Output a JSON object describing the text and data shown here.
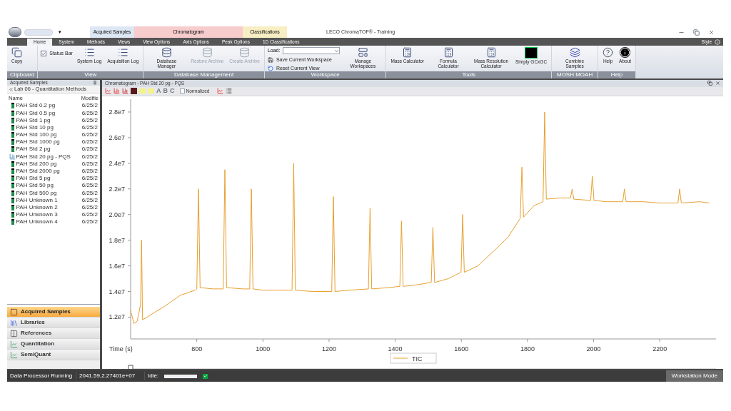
{
  "window": {
    "title": "LECO ChromaTOF® - Training",
    "quick_access_caret": "▾"
  },
  "context_groups": [
    {
      "label": "Acquired Samples",
      "color": "#dde7f4"
    },
    {
      "label": "Chromatogram",
      "color": "#f6cccc"
    },
    {
      "label": "Classifications",
      "color": "#f8eec4"
    }
  ],
  "tabs": [
    {
      "label": "Home",
      "selected": true
    },
    {
      "label": "System",
      "selected": false
    },
    {
      "label": "Methods",
      "selected": false
    },
    {
      "label": "Views",
      "selected": false
    },
    {
      "label": "View Options",
      "selected": false
    },
    {
      "label": "Axis Options",
      "selected": false
    },
    {
      "label": "Peak Options",
      "selected": false
    },
    {
      "label": "1D Classifications",
      "selected": false
    }
  ],
  "style_label": "Style",
  "ribbon": [
    {
      "label": "Clipboard",
      "items": [
        {
          "kind": "copy",
          "label": "Copy"
        }
      ]
    },
    {
      "label": "View",
      "items": [
        {
          "kind": "check",
          "label": "Status Bar",
          "checked": true
        },
        {
          "kind": "log",
          "label": "System Log"
        },
        {
          "kind": "log",
          "label": "Acquisition Log"
        }
      ]
    },
    {
      "label": "Database Management",
      "items": [
        {
          "kind": "database",
          "label": "Database Manager",
          "disabled": false
        },
        {
          "kind": "database",
          "label": "Restore Archive",
          "disabled": true
        },
        {
          "kind": "database",
          "label": "Create Archive",
          "disabled": true
        }
      ]
    },
    {
      "label": "Workspace",
      "items": [
        {
          "kind": "dropdown",
          "label": "Load:"
        },
        {
          "kind": "save",
          "label": "Save Current Workspace"
        },
        {
          "kind": "reset",
          "label": "Reset Current View"
        },
        {
          "kind": "workspace",
          "label": "Manage Workspaces"
        }
      ]
    },
    {
      "label": "Tools",
      "items": [
        {
          "kind": "calculator",
          "label": "Mass Calculator"
        },
        {
          "kind": "calculator",
          "label": "Formula Calculator"
        },
        {
          "kind": "calculator",
          "label": "Mass Resolution Calculator"
        },
        {
          "kind": "screen",
          "label": "Simply GCxGC"
        }
      ]
    },
    {
      "label": "MOSH MOAH",
      "items": [
        {
          "kind": "combine",
          "label": "Combine Samples"
        }
      ]
    },
    {
      "label": "Help",
      "items": [
        {
          "kind": "help",
          "label": "Help"
        },
        {
          "kind": "about",
          "label": "About"
        }
      ]
    }
  ],
  "samples_panel": {
    "title": "Acquired Samples",
    "breadcrumb": "Lab 06 - Quantitation Methods",
    "columns": [
      "Name",
      "Modifie"
    ],
    "rows": [
      {
        "kind": "sample",
        "name": "PAH Std 0.2 pg",
        "modified": "6/25/2"
      },
      {
        "kind": "sample",
        "name": "PAH Std 0.5 pg",
        "modified": "6/25/2"
      },
      {
        "kind": "sample",
        "name": "PAH Std 1 pg",
        "modified": "6/25/2"
      },
      {
        "kind": "sample",
        "name": "PAH Std 10 pg",
        "modified": "6/25/2"
      },
      {
        "kind": "sample",
        "name": "PAH Std 100 pg",
        "modified": "6/25/2"
      },
      {
        "kind": "sample",
        "name": "PAH Std 1000 pg",
        "modified": "6/25/2"
      },
      {
        "kind": "sample",
        "name": "PAH Std 2 pg",
        "modified": "6/25/2"
      },
      {
        "kind": "processed",
        "name": "PAH Std 20 pg - PQS",
        "modified": "6/25/2"
      },
      {
        "kind": "sample",
        "name": "PAH Std 200 pg",
        "modified": "6/25/2"
      },
      {
        "kind": "sample",
        "name": "PAH Std 2000 pg",
        "modified": "6/25/2"
      },
      {
        "kind": "sample",
        "name": "PAH Std 5 pg",
        "modified": "6/25/2"
      },
      {
        "kind": "sample",
        "name": "PAH Std 50 pg",
        "modified": "6/25/2"
      },
      {
        "kind": "sample",
        "name": "PAH Std 500 pg",
        "modified": "6/25/2"
      },
      {
        "kind": "sample",
        "name": "PAH Unknown 1",
        "modified": "6/25/2"
      },
      {
        "kind": "sample",
        "name": "PAH Unknown 2",
        "modified": "6/25/2"
      },
      {
        "kind": "sample",
        "name": "PAH Unknown 3",
        "modified": "6/25/2"
      },
      {
        "kind": "sample",
        "name": "PAH Unknown 4",
        "modified": "6/25/2"
      }
    ]
  },
  "nav": [
    {
      "kind": "samples",
      "label": "Acquired Samples",
      "selected": true
    },
    {
      "kind": "libraries",
      "label": "Libraries",
      "selected": false
    },
    {
      "kind": "references",
      "label": "References",
      "selected": false
    },
    {
      "kind": "curve",
      "label": "Quantitation",
      "selected": false
    },
    {
      "kind": "curve",
      "label": "SemiQuant",
      "selected": false
    }
  ],
  "chromatogram": {
    "title": "Chromatogram - PAH Std 20 pg - PQS",
    "toolbar_letters": [
      "A",
      "B",
      "C"
    ],
    "normalized": {
      "label": "Normalized",
      "checked": false
    },
    "chart_data": {
      "type": "line",
      "xlabel": "Time (s)",
      "xlim": [
        600,
        2370
      ],
      "ylim": [
        10300000,
        29000000
      ],
      "xticks": [
        800,
        1000,
        1200,
        1400,
        1600,
        1800,
        2000,
        2200
      ],
      "yticks": [
        {
          "value": 12000000,
          "label": "1.2e7"
        },
        {
          "value": 14000000,
          "label": "1.4e7"
        },
        {
          "value": 16000000,
          "label": "1.6e7"
        },
        {
          "value": 18000000,
          "label": "1.8e7"
        },
        {
          "value": 20000000,
          "label": "2.0e7"
        },
        {
          "value": 22000000,
          "label": "2.2e7"
        },
        {
          "value": 24000000,
          "label": "2.4e7"
        },
        {
          "value": 26000000,
          "label": "2.6e7"
        },
        {
          "value": 28000000,
          "label": "2.8e7"
        }
      ],
      "x": [
        600,
        605,
        610,
        620,
        630,
        633,
        636,
        650,
        680,
        700,
        750,
        795,
        800,
        805,
        810,
        850,
        880,
        885,
        890,
        940,
        960,
        965,
        970,
        1000,
        1050,
        1088,
        1093,
        1098,
        1150,
        1208,
        1213,
        1218,
        1260,
        1319,
        1324,
        1329,
        1380,
        1414,
        1419,
        1424,
        1460,
        1509,
        1514,
        1519,
        1560,
        1599,
        1604,
        1609,
        1650,
        1700,
        1740,
        1778,
        1783,
        1788,
        1820,
        1847,
        1852,
        1857,
        1900,
        1930,
        1935,
        1940,
        1991,
        1996,
        2001,
        2040,
        2088,
        2093,
        2098,
        2150,
        2200,
        2255,
        2260,
        2265,
        2320,
        2350
      ],
      "series": [
        {
          "name": "TIC",
          "color": "#e8a030",
          "values": [
            12500000,
            12000000,
            11500000,
            11700000,
            13000000,
            18000000,
            11800000,
            12000000,
            12500000,
            12800000,
            13700000,
            14100000,
            14200000,
            22000000,
            14300000,
            14200000,
            14200000,
            23500000,
            14300000,
            14200000,
            14200000,
            22000000,
            14200000,
            14100000,
            14100000,
            14100000,
            24000000,
            14100000,
            14000000,
            14000000,
            21400000,
            14000000,
            14100000,
            14200000,
            20500000,
            14200000,
            14300000,
            14400000,
            19500000,
            14400000,
            14500000,
            14700000,
            19000000,
            14700000,
            15000000,
            15500000,
            20000000,
            15500000,
            16000000,
            17200000,
            18200000,
            19700000,
            23700000,
            19800000,
            20700000,
            21000000,
            28000000,
            21200000,
            21300000,
            21300000,
            22000000,
            21200000,
            21100000,
            23000000,
            21100000,
            21000000,
            21000000,
            22000000,
            21000000,
            21000000,
            20900000,
            20900000,
            22000000,
            20900000,
            21000000,
            20900000
          ]
        }
      ]
    }
  },
  "status_bar": {
    "message": "Data Processor Running",
    "cursor": "2041.59,2.27401e+07",
    "idle_label": "Idle:",
    "idle_progress": {
      "level": 1
    },
    "mode": "Workstation Mode"
  }
}
